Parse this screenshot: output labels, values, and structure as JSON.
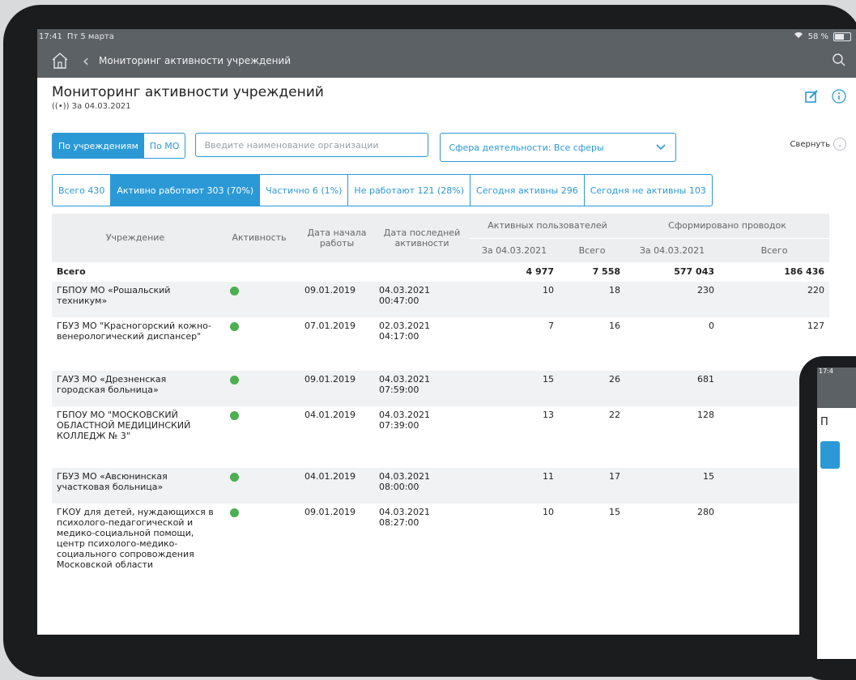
{
  "status": {
    "time": "17:41",
    "date": "Пт 5 марта",
    "battery": "58 %"
  },
  "nav": {
    "title": "Мониторинг активности учреждений"
  },
  "page": {
    "title": "Мониторинг активности учреждений",
    "subtitle": "((•)) За 04.03.2021",
    "collapse": "Свернуть"
  },
  "filters": {
    "seg_inst": "По учреждениям",
    "seg_mo": "По МО",
    "search_placeholder": "Введите наименование организации",
    "sphere": "Сфера деятельности: Все сферы"
  },
  "tabs": [
    "Всего 430",
    "Активно работают 303 (70%)",
    "Частично 6 (1%)",
    "Не работают 121 (28%)",
    "Сегодня активны 296",
    "Сегодня не активны 103"
  ],
  "table": {
    "headers": {
      "institution": "Учреждение",
      "activity": "Активность",
      "start": "Дата начала работы",
      "last": "Дата последней активности",
      "users": "Активных пользователей",
      "entries": "Сформировано проводок",
      "users_date": "За 04.03.2021",
      "users_total": "Всего",
      "entries_date": "За 04.03.2021",
      "entries_total": "Всего"
    },
    "total": {
      "label": "Всего",
      "u1": "4 977",
      "u2": "7 558",
      "e1": "577 043",
      "e2": "186 436"
    },
    "rows": [
      {
        "name": "ГБПОУ МО «Рошальский техникум»",
        "start": "09.01.2019",
        "last_date": "04.03.2021",
        "last_time": "00:47:00",
        "u1": "10",
        "u2": "18",
        "e1": "230",
        "e2": "220"
      },
      {
        "name": "ГБУЗ МО \"Красногорский кожно-венерологический диспансер\"",
        "start": "07.01.2019",
        "last_date": "02.03.2021",
        "last_time": "04:17:00",
        "u1": "7",
        "u2": "16",
        "e1": "0",
        "e2": "127"
      },
      {
        "name": "ГАУЗ МО «Дрезненская городская больница»",
        "start": "09.01.2019",
        "last_date": "04.03.2021",
        "last_time": "07:59:00",
        "u1": "15",
        "u2": "26",
        "e1": "681",
        "e2": ""
      },
      {
        "name": "ГБПОУ МО \"МОСКОВСКИЙ ОБЛАСТНОЙ МЕДИЦИНСКИЙ КОЛЛЕДЖ № 3\"",
        "start": "04.01.2019",
        "last_date": "04.03.2021",
        "last_time": "07:39:00",
        "u1": "13",
        "u2": "22",
        "e1": "128",
        "e2": ""
      },
      {
        "name": "ГБУЗ МО «Авсюнинская участковая больница»",
        "start": "04.01.2019",
        "last_date": "04.03.2021",
        "last_time": "08:00:00",
        "u1": "11",
        "u2": "17",
        "e1": "15",
        "e2": ""
      },
      {
        "name": "ГКОУ для детей, нуждающихся в психолого-педагогической и медико-социальной помощи, центр психолого-медико-социального сопровождения Московской области",
        "start": "09.01.2019",
        "last_date": "04.03.2021",
        "last_time": "08:27:00",
        "u1": "10",
        "u2": "15",
        "e1": "280",
        "e2": ""
      }
    ]
  },
  "second_tablet": {
    "time": "17:4",
    "title": "П"
  },
  "colors": {
    "accent": "#2b99d6",
    "navbar": "#5c6166",
    "active_dot": "#4caf50"
  }
}
